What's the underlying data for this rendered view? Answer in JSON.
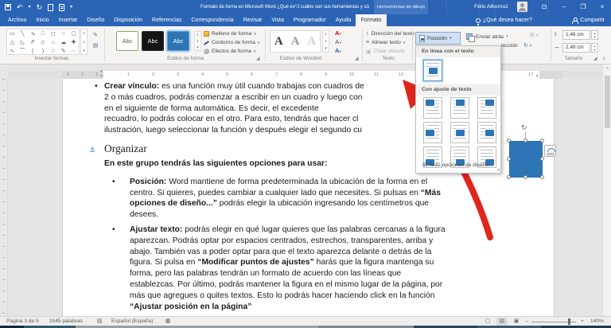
{
  "colors": {
    "titlebar": "#2b64b4",
    "accent": "#2b579a",
    "shape_fill": "#2e75b6",
    "arrow_red": "#e0251b"
  },
  "icons": {
    "dd": "▾",
    "up": "▴",
    "undo": "↶",
    "redo": "↻",
    "more": "⋯",
    "chev_up": "∧",
    "chev_dn": "∨",
    "anchor": "⚓",
    "grid": "⊞",
    "rotate": "↻",
    "height": "↕",
    "width": "↔",
    "launcher": "◢",
    "min": "–",
    "restore": "❐",
    "close": "×",
    "ribopts": "⊡",
    "grip": "◢",
    "align_grey": "⊞",
    "proofing": "▤",
    "macro": "▦",
    "view_read": "▢",
    "view_print": "▤",
    "view_web": "▣",
    "zoom_minus": "–",
    "zoom_plus": "+",
    "dir_text": "↕",
    "align_text": "≡",
    "link": "▣",
    "shape_edit": "✎",
    "text_box": "▤"
  },
  "titlebar": {
    "title": "Formato de forma en Microsoft Word ¿Qué es^J cuáles son sus herramientas y cómo configurarlo - Word",
    "context_group": "Herramientas de dibujo",
    "user_name": "Félix Albornoz"
  },
  "tabs": {
    "items": [
      "Archivo",
      "Inicio",
      "Insertar",
      "Diseño",
      "Disposición",
      "Referencias",
      "Correspondencia",
      "Revisar",
      "Vista",
      "Programador",
      "Ayuda",
      "Formato"
    ],
    "active": "Formato",
    "tell_me": "¿Qué desea hacer?",
    "share": "Compartir"
  },
  "ribbon": {
    "insert_shapes": {
      "label": "Insertar formas",
      "glyphs": [
        "▭",
        "╲",
        "⇘",
        "□",
        "◻",
        "○",
        "▢",
        "△",
        "◺",
        "↱",
        "◇",
        "⌂",
        "☁",
        "✚",
        "∿",
        "⌒",
        "(",
        ")",
        "☆",
        "✎",
        "⋯"
      ]
    },
    "shape_styles": {
      "label": "Estilos de forma",
      "presets": [
        "Abc",
        "Abc",
        "Abc"
      ],
      "fill": "Relleno de forma",
      "outline": "Contorno de forma",
      "effects": "Efectos de forma"
    },
    "wordart": {
      "label": "Estilos de WordArt",
      "letters": [
        "A",
        "A",
        "A"
      ],
      "minis": [
        "A",
        "A",
        "A"
      ]
    },
    "text_group": {
      "label": "Texto",
      "direction": "Dirección del texto",
      "align": "Alinear texto",
      "link": "Crear vínculo"
    },
    "arrange": {
      "position": "Posición",
      "send_back": "Enviar atrás",
      "selection_partial": "lección"
    },
    "size": {
      "label": "Tamaño",
      "height_value": "1,48 cm",
      "width_value": "2,48 cm"
    }
  },
  "position_menu": {
    "inline_header": "En línea con el texto",
    "wrap_header": "Con ajuste de texto",
    "footer": "Más opciones de diseño...",
    "wrap_positions": [
      "tl",
      "tc",
      "tr",
      "ml",
      "mc",
      "mr",
      "bl",
      "bc",
      "br"
    ]
  },
  "ruler": {
    "margin_numbers": [
      "3",
      "2",
      "1"
    ],
    "numbers": [
      "1",
      "2",
      "3",
      "4",
      "5",
      "6",
      "7",
      "8",
      "9",
      "10",
      "11",
      "12"
    ],
    "far_number": "17"
  },
  "document": {
    "blocks": [
      {
        "cls": "b1",
        "lines": [
          [
            {
              "b": true,
              "t": "Crear vínculo:"
            },
            {
              "t": " es una función muy útil cuando trabajas con cuadros de"
            }
          ],
          [
            {
              "t": "2 o más cuadros, podrás comenzar a escribir en un cuadro y luego con"
            }
          ],
          [
            {
              "t": "en el siguiente de forma automática. Es decir, el excedente"
            }
          ],
          [
            {
              "t": "recuadro, lo podrás colocar en el otro. Para esto, tendrás que hacer cl"
            }
          ],
          [
            {
              "t": "ilustración, luego seleccionar la función y después elegir el segundo cu"
            }
          ]
        ]
      },
      {
        "cls": "h",
        "anchor": true,
        "lines": [
          [
            {
              "t": "Organizar"
            }
          ]
        ]
      },
      {
        "cls": "intro",
        "lines": [
          [
            {
              "b": true,
              "t": "En este grupo tendrás las siguientes opciones para usar:"
            }
          ]
        ]
      },
      {
        "cls": "b2 p1",
        "lines": [
          [
            {
              "b": true,
              "t": "Posición:"
            },
            {
              "t": " Word mantiene de forma predeterminada la ubicación de la forma en el"
            }
          ],
          [
            {
              "t": "centro. Si quieres, puedes cambiar a cualquier lado que necesites. Si pulsas en "
            },
            {
              "b": true,
              "t": "“Más"
            }
          ],
          [
            {
              "b": true,
              "t": "opciones de diseño...”"
            },
            {
              "t": " podrás elegir la ubicación ingresando los centímetros que"
            }
          ],
          [
            {
              "t": "desees."
            }
          ]
        ]
      },
      {
        "cls": "b2 p2",
        "lines": [
          [
            {
              "b": true,
              "t": "Ajustar texto:"
            },
            {
              "t": " podrás elegir en qué lugar quieres que las palabras cercanas a la figura"
            }
          ],
          [
            {
              "t": "aparezcan. Podrás optar por espacios centrados, estrechos, transparentes, arriba y"
            }
          ],
          [
            {
              "t": "abajo. También vas a poder optar para que el texto aparezca delante o detrás de la"
            }
          ],
          [
            {
              "t": "figura. Si pulsa en "
            },
            {
              "b": true,
              "t": "“Modificar puntos de ajustes”"
            },
            {
              "t": " harás que la figura mantenga su"
            }
          ],
          [
            {
              "t": "forma, pero las palabras tendrán un formato de acuerdo con las líneas que"
            }
          ],
          [
            {
              "t": "establezcas. Por último, podrás mantener la figura en el mismo lugar de la página, por"
            }
          ],
          [
            {
              "t": "más que agregues o quites textos. Esto lo podrás hacer haciendo click en la función"
            }
          ],
          [
            {
              "b": true,
              "t": "“Ajustar posición en la página”"
            }
          ]
        ]
      }
    ]
  },
  "statusbar": {
    "page": "Página 3 de 5",
    "words": "1545 palabras",
    "language": "Español (España)",
    "zoom": "140%"
  }
}
